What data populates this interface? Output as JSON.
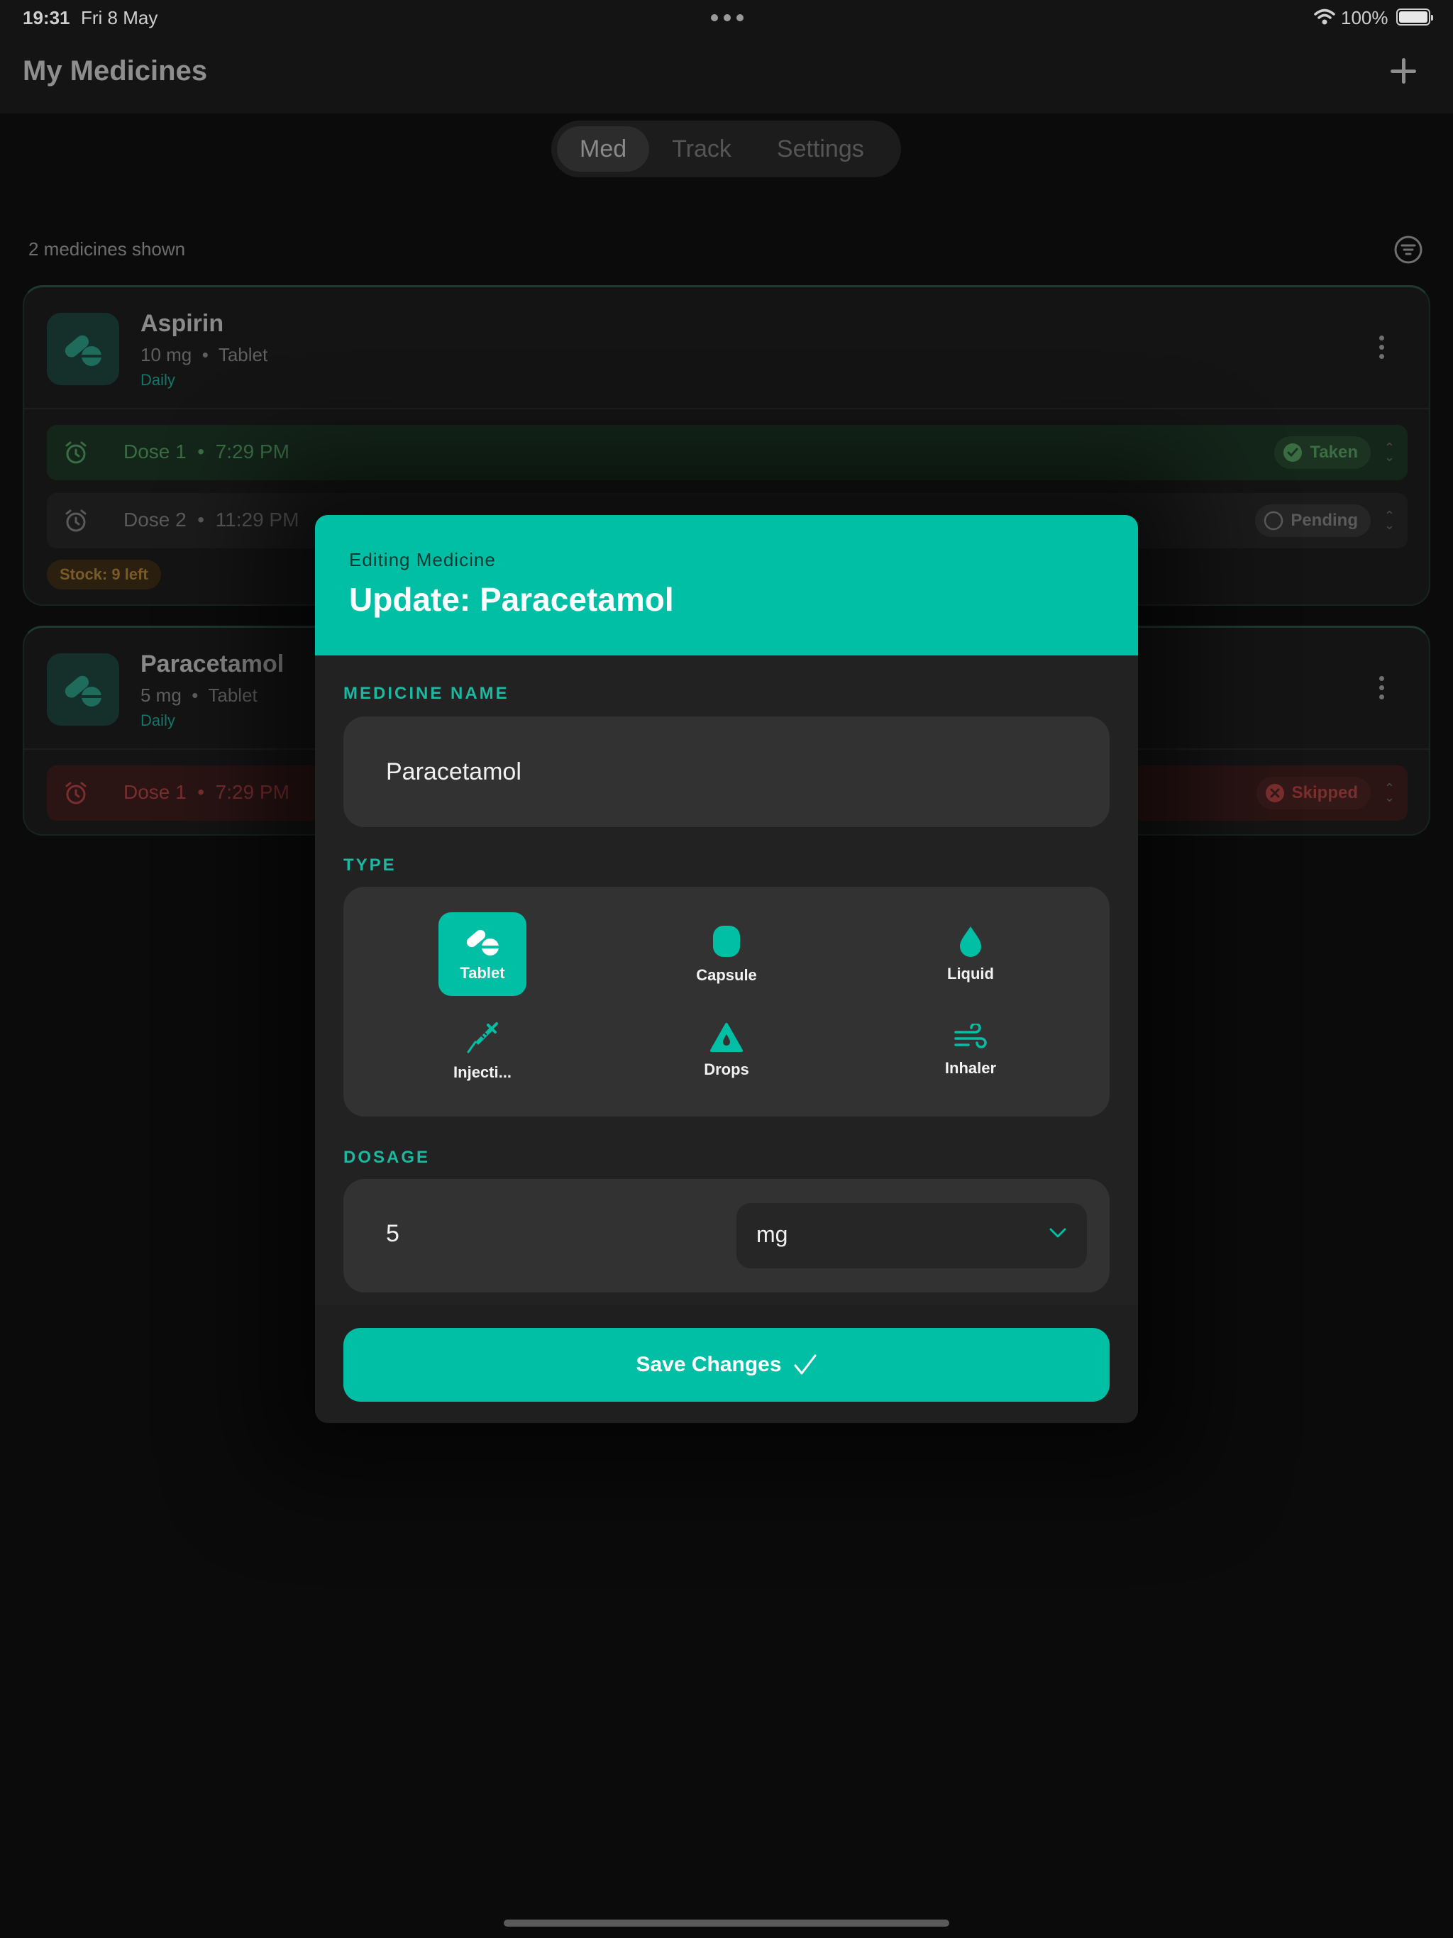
{
  "status_bar": {
    "time": "19:31",
    "date": "Fri 8 May",
    "battery": "100%"
  },
  "nav": {
    "title": "My Medicines"
  },
  "tabs": [
    {
      "label": "Med",
      "active": true
    },
    {
      "label": "Track",
      "active": false
    },
    {
      "label": "Settings",
      "active": false
    }
  ],
  "list": {
    "count_text": "2 medicines shown",
    "medicines": [
      {
        "name": "Aspirin",
        "dose": "10 mg",
        "form": "Tablet",
        "frequency": "Daily",
        "doses": [
          {
            "label": "Dose 1",
            "time": "7:29 PM",
            "status": "Taken"
          },
          {
            "label": "Dose 2",
            "time": "11:29 PM",
            "status": "Pending"
          }
        ],
        "stock": "Stock: 9 left"
      },
      {
        "name": "Paracetamol",
        "dose": "5 mg",
        "form": "Tablet",
        "frequency": "Daily",
        "doses": [
          {
            "label": "Dose 1",
            "time": "7:29 PM",
            "status": "Skipped"
          }
        ]
      }
    ]
  },
  "modal": {
    "eyebrow": "Editing Medicine",
    "title": "Update: Paracetamol",
    "name_label": "MEDICINE NAME",
    "name_value": "Paracetamol",
    "type_label": "TYPE",
    "types": [
      {
        "label": "Tablet",
        "icon": "pills-icon",
        "selected": true
      },
      {
        "label": "Capsule",
        "icon": "capsule-icon",
        "selected": false
      },
      {
        "label": "Liquid",
        "icon": "drop-icon",
        "selected": false
      },
      {
        "label": "Injecti...",
        "icon": "syringe-icon",
        "selected": false
      },
      {
        "label": "Drops",
        "icon": "drops-icon",
        "selected": false
      },
      {
        "label": "Inhaler",
        "icon": "wind-icon",
        "selected": false
      }
    ],
    "dosage_label": "DOSAGE",
    "dosage_amount": "5",
    "dosage_unit": "mg",
    "save_label": "Save Changes"
  },
  "colors": {
    "accent": "#00bfa5",
    "taken": "#3b6d43",
    "skipped": "#7a2e2e",
    "stock": "#7a5a26"
  }
}
